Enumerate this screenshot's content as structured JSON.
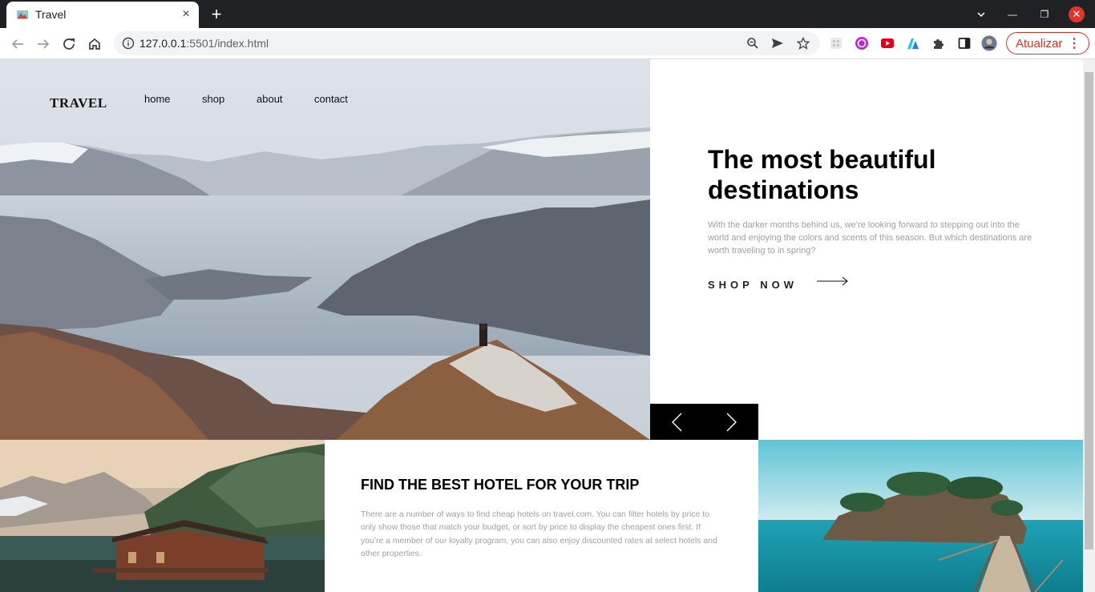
{
  "browser": {
    "tab_title": "Travel",
    "tab_close": "×",
    "new_tab": "+",
    "url_host": "127.0.0.1",
    "url_rest": ":5501/index.html",
    "update_label": "Atualizar",
    "update_menu": "⋮",
    "window_min": "—",
    "window_restore": "❐",
    "window_close": "✕"
  },
  "site": {
    "logo": "TRAVEL",
    "nav": [
      "home",
      "shop",
      "about",
      "contact"
    ]
  },
  "hero": {
    "title": "The most beautiful destinations",
    "description": "With the darker months behind us, we’re looking forward to stepping out into the world and enjoying the colors and scents of this season. But which destinations are worth traveling to in spring?",
    "cta": "SHOP NOW"
  },
  "hotel": {
    "title": "FIND THE BEST HOTEL FOR YOUR TRIP",
    "description": "There are a number of ways to find cheap hotels on travel.com. You can filter hotels by price to only show those that match your budget, or sort by price to display the cheapest ones first. If you’re a member of our loyalty program, you can also enjoy discounted rates at select hotels and other properties."
  },
  "colors": {
    "browser_frame": "#202124",
    "accent_update": "#d93025",
    "text_muted": "#a0a0a0"
  }
}
